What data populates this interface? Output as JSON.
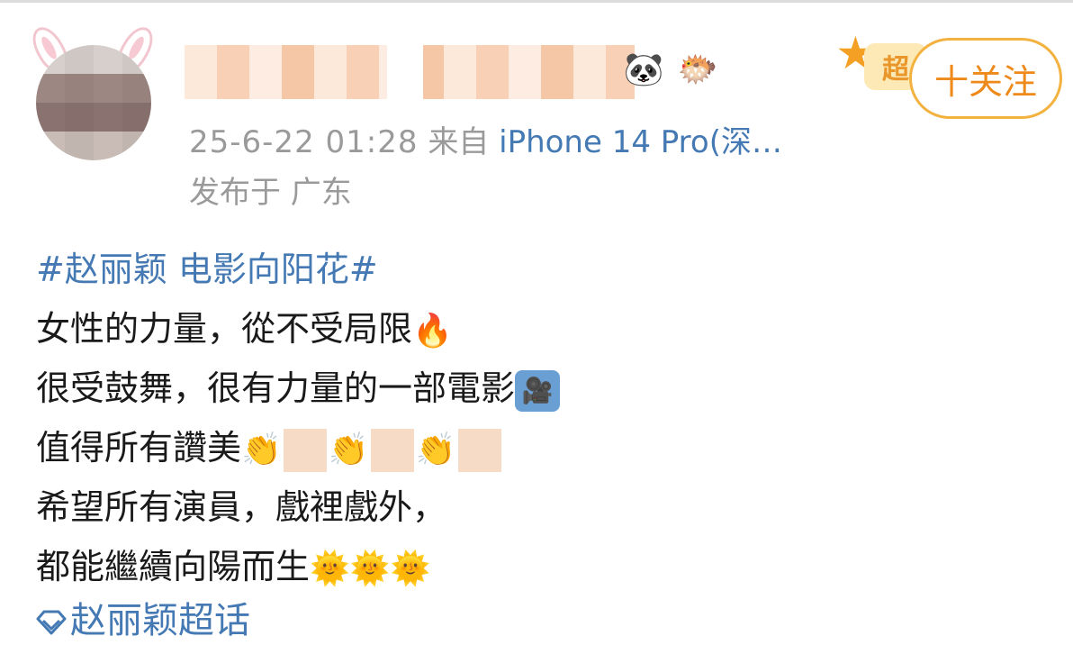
{
  "user": {
    "name": "",
    "badges": [
      "panda-icon",
      "fish-icon"
    ],
    "super_tag": "超",
    "follow_label": "十关注"
  },
  "post_meta": {
    "time": "25-6-22 01:28",
    "source_prefix": "来自",
    "source_device": "iPhone 14 Pro(深…",
    "location": "发布于 广东"
  },
  "content": {
    "hashtag": "#赵丽颖 电影向阳花#",
    "line1": "女性的力量，從不受局限",
    "line1_emoji": "🔥",
    "line2": "很受鼓舞，很有力量的一部電影",
    "line2_emoji": "🎥",
    "line3": "值得所有讚美",
    "line3_emoji": "👏",
    "line4": "希望所有演員，戲裡戲外，",
    "line5": "都能繼續向陽而生",
    "line5_emoji": "🌞"
  },
  "topic": {
    "label": "赵丽颖超话"
  },
  "colors": {
    "link_blue": "#4479b4",
    "follow_orange": "#ee8a1a",
    "meta_gray": "#9a9a9a"
  }
}
